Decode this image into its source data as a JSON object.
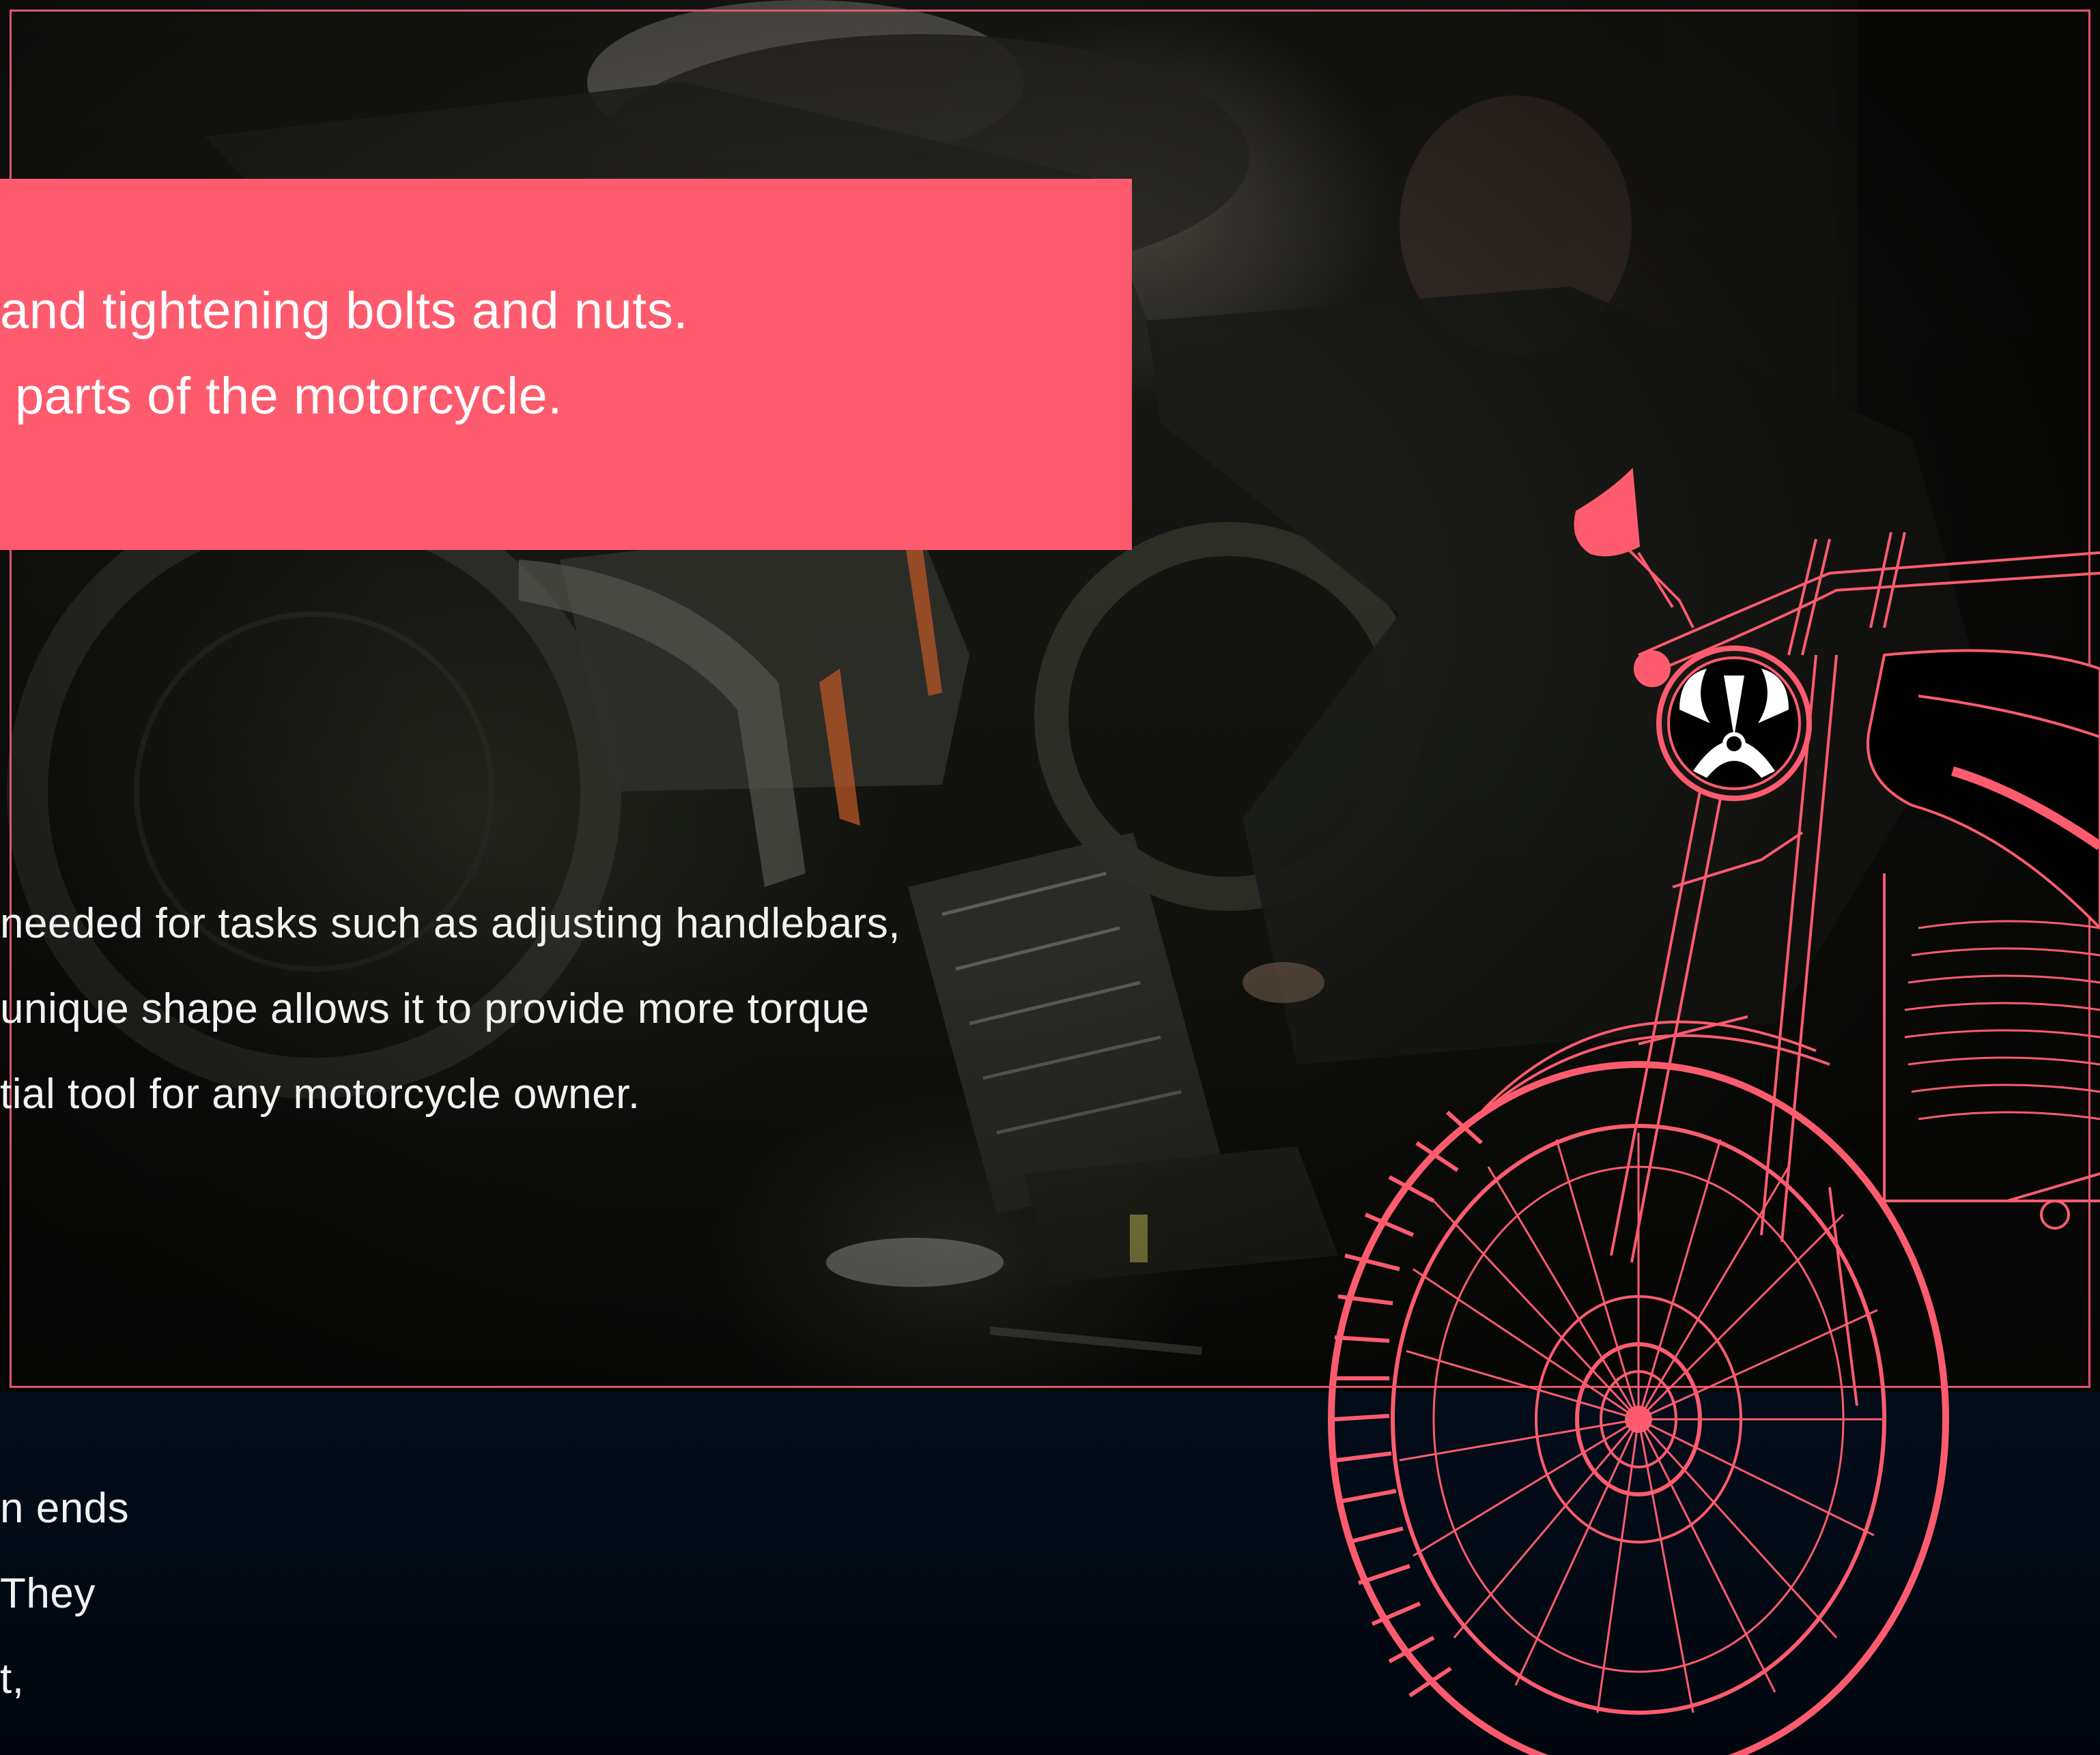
{
  "highlight_box": {
    "lines": [
      "and tightening bolts and nuts.",
      "parts of the motorcycle."
    ]
  },
  "body_text": {
    "lines": [
      "needed for tasks such as adjusting handlebars,",
      "unique shape allows it to provide more torque",
      "tial tool for any motorcycle owner."
    ]
  },
  "footer_text": {
    "lines": [
      "n ends",
      "They",
      "t,"
    ]
  },
  "colors": {
    "accent": "#fe5c6e",
    "frame": "#e0566b",
    "background": "#020a14"
  },
  "illustration": {
    "icon": "motorcycle-outline-icon",
    "headlight_emblem": "horned-skull-emblem-icon"
  }
}
